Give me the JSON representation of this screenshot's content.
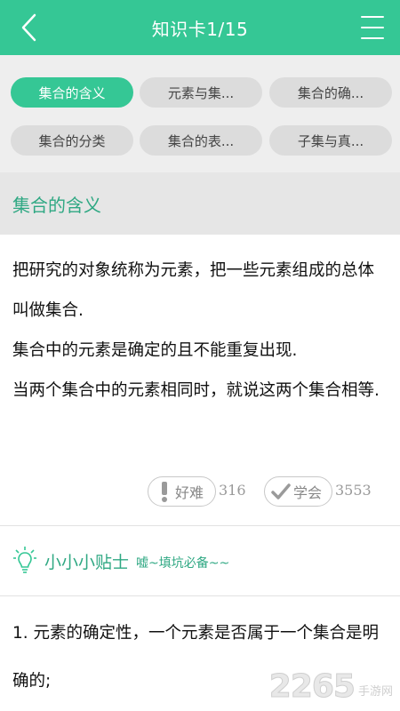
{
  "header": {
    "title": "知识卡1/15",
    "back_icon": "chevron-left-icon",
    "menu_icon": "hamburger-menu-icon"
  },
  "tags": [
    {
      "label": "集合的含义",
      "active": true
    },
    {
      "label": "元素与集...",
      "active": false
    },
    {
      "label": "集合的确...",
      "active": false
    },
    {
      "label": "集合的分类",
      "active": false
    },
    {
      "label": "集合的表...",
      "active": false
    },
    {
      "label": "子集与真...",
      "active": false
    }
  ],
  "section": {
    "title": "集合的含义"
  },
  "content": {
    "paragraphs": [
      "把研究的对象统称为元素，把一些元素组成的总体叫做集合.",
      "集合中的元素是确定的且不能重复出现.",
      "当两个集合中的元素相同时，就说这两个集合相等."
    ]
  },
  "stats": {
    "hard_label": "好难",
    "hard_count": "316",
    "learned_label": "学会",
    "learned_count": "3553"
  },
  "tips": {
    "title": "小小小贴士",
    "subtitle": "嘘~填坑必备~~",
    "item1": "1. 元素的确定性，一个元素是否属于一个集合是明确的;"
  },
  "watermark": {
    "number": "2265",
    "text": "手游网"
  },
  "colors": {
    "accent": "#35c795",
    "accent_text": "#2fa883",
    "tag_bg": "#dcdcdc"
  }
}
